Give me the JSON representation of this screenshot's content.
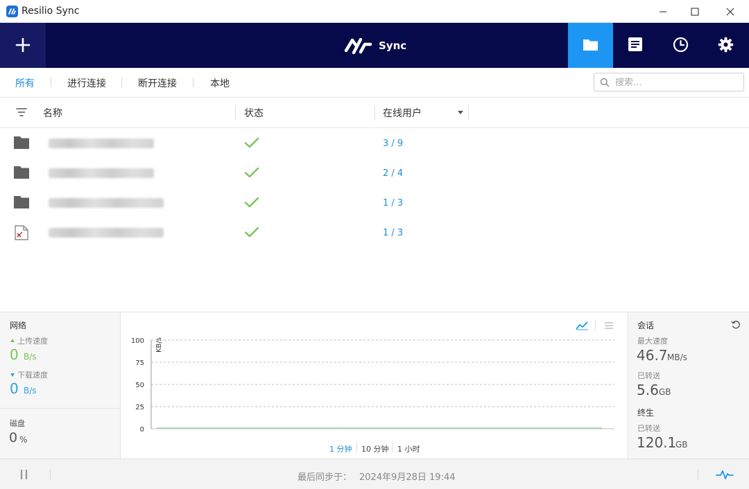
{
  "window": {
    "title": "Resilio Sync"
  },
  "header": {
    "brand": "Sync"
  },
  "filters": {
    "tabs": [
      {
        "label": "所有",
        "active": true
      },
      {
        "label": "进行连接",
        "active": false
      },
      {
        "label": "断开连接",
        "active": false
      },
      {
        "label": "本地",
        "active": false
      }
    ],
    "search_placeholder": "搜索..."
  },
  "table": {
    "columns": [
      "名称",
      "状态",
      "在线用户"
    ],
    "rows": [
      {
        "icon": "folder-icon",
        "online": "3 / 9"
      },
      {
        "icon": "folder-icon",
        "online": "2 / 4"
      },
      {
        "icon": "folder-icon",
        "online": "1 / 3"
      },
      {
        "icon": "broken-folder-icon",
        "online": "1 / 3"
      }
    ]
  },
  "network": {
    "title": "网络",
    "upload_label": "上传速度",
    "upload_value": "0",
    "upload_unit": "B/s",
    "download_label": "下载速度",
    "download_value": "0",
    "download_unit": "B/s"
  },
  "disk": {
    "title": "磁盘",
    "value": "0",
    "unit": "%"
  },
  "chart": {
    "ranges": [
      "1 分钟",
      "10 分钟",
      "1 小时"
    ],
    "active_range": "1 分钟"
  },
  "chart_data": {
    "type": "line",
    "ylabel": "KB/s",
    "ylim": [
      0,
      100
    ],
    "yticks": [
      "100",
      "75",
      "50",
      "25",
      "0"
    ],
    "grid": true,
    "series": [
      {
        "values": [
          0,
          0,
          0,
          0,
          0,
          0,
          0,
          0,
          0,
          0,
          0,
          0
        ]
      }
    ]
  },
  "session": {
    "title": "会话",
    "max_speed_label": "最大速度",
    "max_speed_value": "46.7",
    "max_speed_unit": "MB/s",
    "transferred_label": "已转送",
    "transferred_value": "5.6",
    "transferred_unit": "GB"
  },
  "lifetime": {
    "title": "终生",
    "transferred_label": "已转送",
    "transferred_value": "120.1",
    "transferred_unit": "GB"
  },
  "statusbar": {
    "last_sync_label": "最后同步于：",
    "last_sync_date": "2024年9月28日 19:44"
  },
  "colors": {
    "navy": "#070a4a",
    "accent": "#1d96f3",
    "link": "#1d8fd6",
    "success": "#7ac35a"
  }
}
